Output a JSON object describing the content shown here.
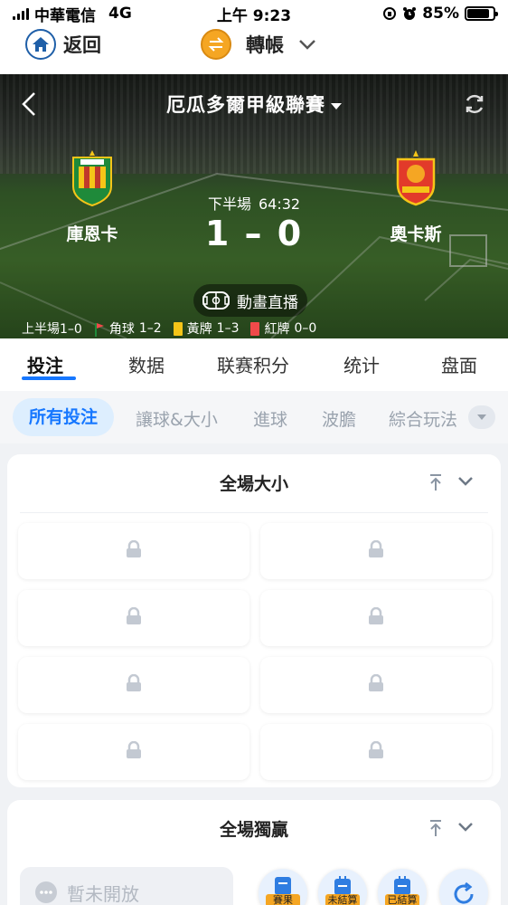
{
  "status_bar": {
    "carrier": "中華電信",
    "network": "4G",
    "time": "上午 9:23",
    "battery_percent": "85%",
    "battery_level": 0.85
  },
  "top_nav": {
    "back_label": "返回",
    "transfer_label": "轉帳"
  },
  "match": {
    "league": "厄瓜多爾甲級聯賽",
    "home_team": "庫恩卡",
    "away_team": "奧卡斯",
    "period": "下半場",
    "clock": "64:32",
    "score": "1 – 0",
    "live_label": "動畫直播",
    "half_time": "上半場1–0",
    "corners_label": "角球",
    "corners_value": "1–2",
    "yellow_label": "黃牌",
    "yellow_value": "1–3",
    "red_label": "紅牌",
    "red_value": "0–0"
  },
  "tabs": [
    "投注",
    "数据",
    "联赛积分",
    "统计",
    "盘面"
  ],
  "sub_tabs": [
    "所有投注",
    "讓球&大小",
    "進球",
    "波膽",
    "綜合玩法"
  ],
  "markets": [
    {
      "title": "全場大小"
    },
    {
      "title": "全場獨贏"
    }
  ],
  "bottom": {
    "closed_label": "暫未開放",
    "fab_1": "賽果",
    "fab_2": "未結算",
    "fab_3": "已結算"
  },
  "colors": {
    "accent": "#1677ff",
    "yellow_card": "#f5c518",
    "red_card": "#f04a4a",
    "brand_orange": "#f5a623"
  }
}
